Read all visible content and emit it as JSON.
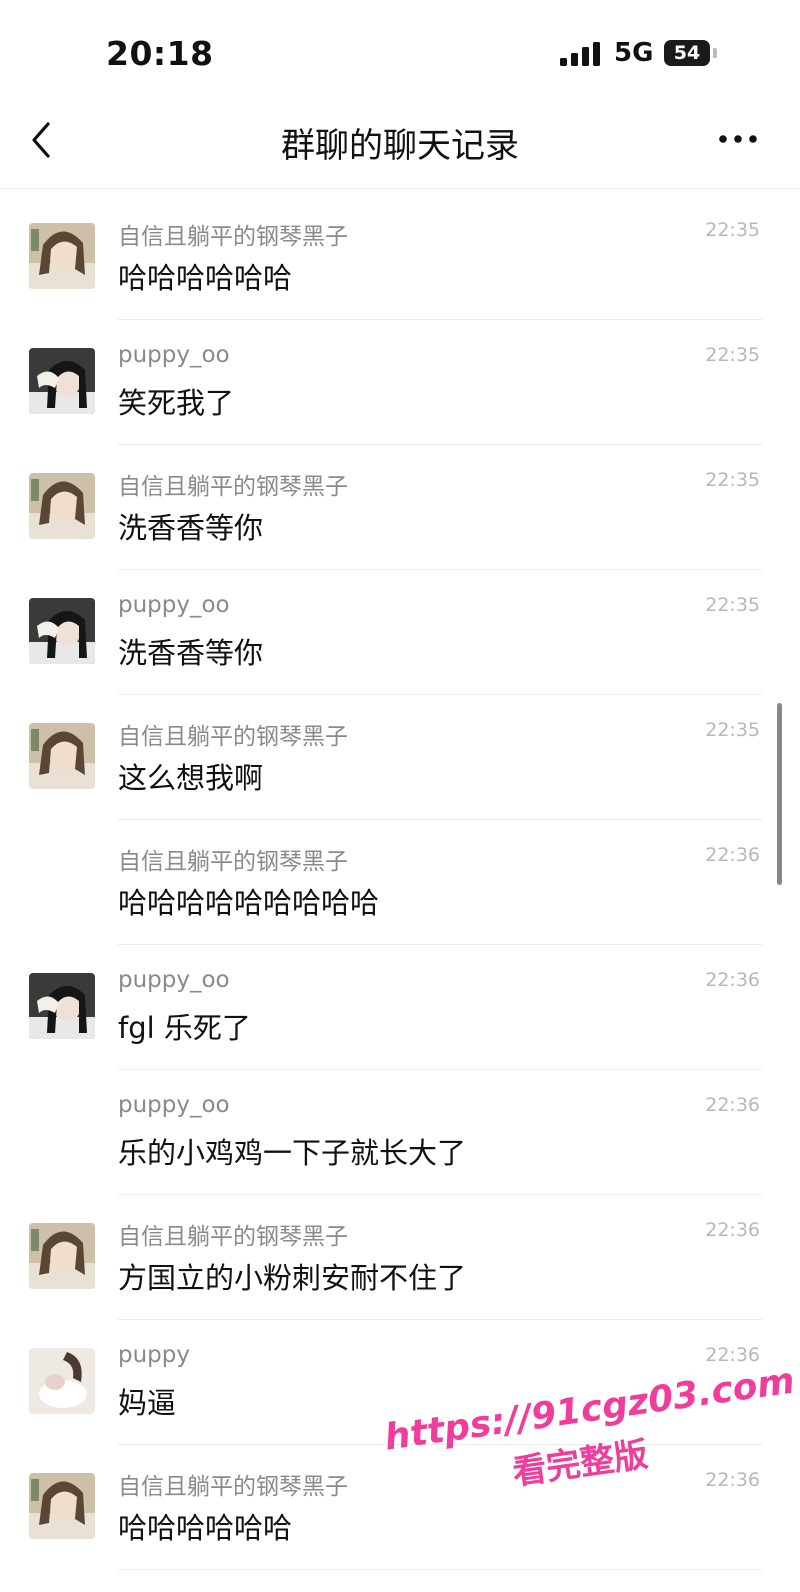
{
  "status_bar": {
    "time": "20:18",
    "network": "5G",
    "battery": "54"
  },
  "nav": {
    "title": "群聊的聊天记录",
    "back_icon": "chevron-left-icon",
    "more_icon": "more-dots-icon"
  },
  "messages": [
    {
      "sender": "自信且躺平的钢琴黑子",
      "time": "22:35",
      "text": "哈哈哈哈哈哈",
      "avatar": "a"
    },
    {
      "sender": "puppy_oo",
      "time": "22:35",
      "text": "笑死我了",
      "avatar": "b"
    },
    {
      "sender": "自信且躺平的钢琴黑子",
      "time": "22:35",
      "text": "洗香香等你",
      "avatar": "a"
    },
    {
      "sender": "puppy_oo",
      "time": "22:35",
      "text": "洗香香等你",
      "avatar": "b"
    },
    {
      "sender": "自信且躺平的钢琴黑子",
      "time": "22:35",
      "text": "这么想我啊",
      "avatar": "a"
    },
    {
      "sender": "自信且躺平的钢琴黑子",
      "time": "22:36",
      "text": "哈哈哈哈哈哈哈哈哈",
      "avatar": ""
    },
    {
      "sender": "puppy_oo",
      "time": "22:36",
      "text": "fgl 乐死了",
      "avatar": "b"
    },
    {
      "sender": "puppy_oo",
      "time": "22:36",
      "text": "乐的小鸡鸡一下子就长大了",
      "avatar": ""
    },
    {
      "sender": "自信且躺平的钢琴黑子",
      "time": "22:36",
      "text": "方国立的小粉刺安耐不住了",
      "avatar": "a"
    },
    {
      "sender": "puppy",
      "time": "22:36",
      "text": "妈逼",
      "avatar": "c"
    },
    {
      "sender": "自信且躺平的钢琴黑子",
      "time": "22:36",
      "text": "哈哈哈哈哈哈",
      "avatar": "a"
    }
  ],
  "watermark": {
    "url": "https://91cgz03.com",
    "subtitle": "看完整版",
    "color": "#f03c9a"
  }
}
